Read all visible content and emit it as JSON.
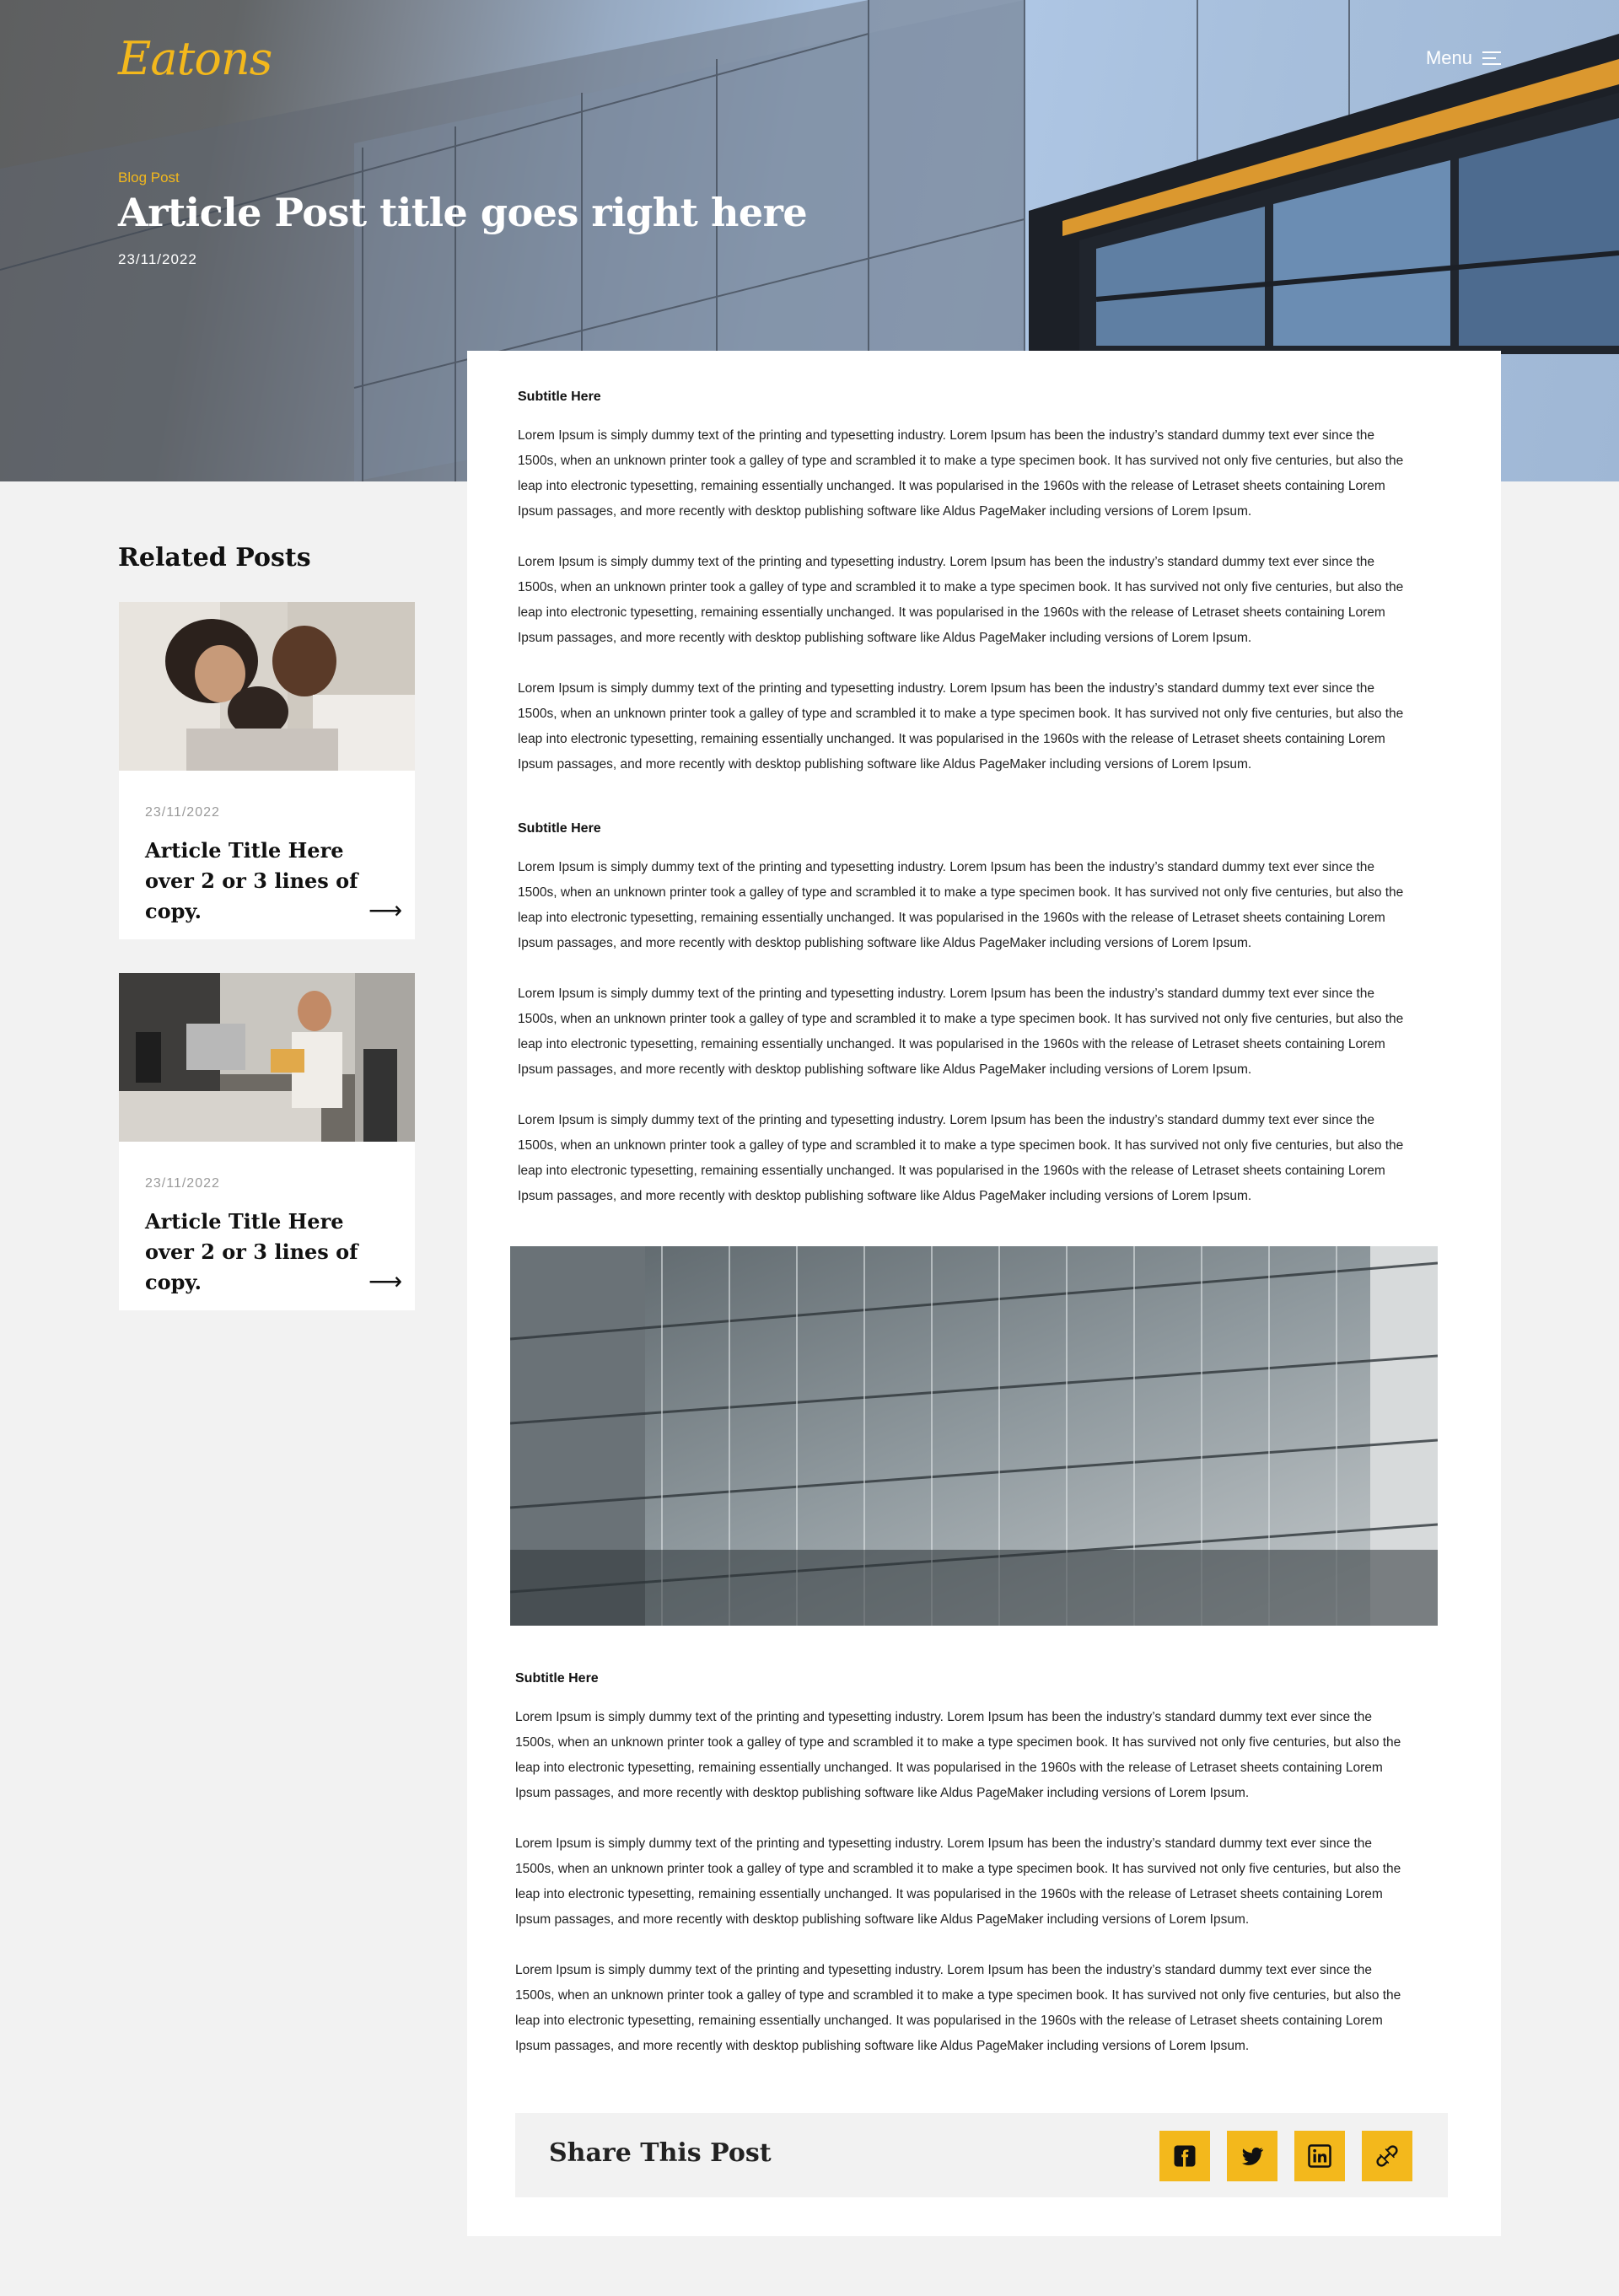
{
  "brand": {
    "logo_text": "Eatons",
    "accent": "#f3b81c"
  },
  "nav": {
    "menu_label": "Menu"
  },
  "hero": {
    "kicker": "Blog Post",
    "title": "Article Post title goes right here",
    "date": "23/11/2022"
  },
  "sidebar": {
    "heading": "Related Posts",
    "cards": [
      {
        "date": "23/11/2022",
        "title": "Article Title Here over 2 or 3 lines of copy.",
        "image": "family-photo"
      },
      {
        "date": "23/11/2022",
        "title": "Article Title Here over 2 or 3 lines of copy.",
        "image": "office-photo"
      }
    ]
  },
  "article": {
    "sections": [
      {
        "subtitle": "Subtitle Here",
        "paragraphs": [
          "Lorem Ipsum is simply dummy text of the printing and typesetting industry. Lorem Ipsum has been the industry’s standard dummy text ever since the 1500s, when an unknown printer took a galley of type and scrambled it to make a type specimen book. It has survived not only five centuries, but also the leap into electronic typesetting, remaining essentially unchanged. It was popularised in the 1960s with the release of Letraset sheets containing Lorem Ipsum passages, and more recently with desktop publishing software like Aldus PageMaker including versions of Lorem Ipsum.",
          "Lorem Ipsum is simply dummy text of the printing and typesetting industry. Lorem Ipsum has been the industry’s standard dummy text ever since the 1500s, when an unknown printer took a galley of type and scrambled it to make a type specimen book. It has survived not only five centuries, but also the leap into electronic typesetting, remaining essentially unchanged. It was popularised in the 1960s with the release of Letraset sheets containing Lorem Ipsum passages, and more recently with desktop publishing software like Aldus PageMaker including versions of Lorem Ipsum.",
          "Lorem Ipsum is simply dummy text of the printing and typesetting industry. Lorem Ipsum has been the industry’s standard dummy text ever since the 1500s, when an unknown printer took a galley of type and scrambled it to make a type specimen book. It has survived not only five centuries, but also the leap into electronic typesetting, remaining essentially unchanged. It was popularised in the 1960s with the release of Letraset sheets containing Lorem Ipsum passages, and more recently with desktop publishing software like Aldus PageMaker including versions of Lorem Ipsum."
        ]
      },
      {
        "subtitle": "Subtitle Here",
        "paragraphs": [
          "Lorem Ipsum is simply dummy text of the printing and typesetting industry. Lorem Ipsum has been the industry’s standard dummy text ever since the 1500s, when an unknown printer took a galley of type and scrambled it to make a type specimen book. It has survived not only five centuries, but also the leap into electronic typesetting, remaining essentially unchanged. It was popularised in the 1960s with the release of Letraset sheets containing Lorem Ipsum passages, and more recently with desktop publishing software like Aldus PageMaker including versions of Lorem Ipsum.",
          "Lorem Ipsum is simply dummy text of the printing and typesetting industry. Lorem Ipsum has been the industry’s standard dummy text ever since the 1500s, when an unknown printer took a galley of type and scrambled it to make a type specimen book. It has survived not only five centuries, but also the leap into electronic typesetting, remaining essentially unchanged. It was popularised in the 1960s with the release of Letraset sheets containing Lorem Ipsum passages, and more recently with desktop publishing software like Aldus PageMaker including versions of Lorem Ipsum.",
          "Lorem Ipsum is simply dummy text of the printing and typesetting industry. Lorem Ipsum has been the industry’s standard dummy text ever since the 1500s, when an unknown printer took a galley of type and scrambled it to make a type specimen book. It has survived not only five centuries, but also the leap into electronic typesetting, remaining essentially unchanged. It was popularised in the 1960s with the release of Letraset sheets containing Lorem Ipsum passages, and more recently with desktop publishing software like Aldus PageMaker including versions of Lorem Ipsum."
        ]
      },
      {
        "subtitle": "Subtitle Here",
        "paragraphs": [
          "Lorem Ipsum is simply dummy text of the printing and typesetting industry. Lorem Ipsum has been the industry’s standard dummy text ever since the 1500s, when an unknown printer took a galley of type and scrambled it to make a type specimen book. It has survived not only five centuries, but also the leap into electronic typesetting, remaining essentially unchanged. It was popularised in the 1960s with the release of Letraset sheets containing Lorem Ipsum passages, and more recently with desktop publishing software like Aldus PageMaker including versions of Lorem Ipsum.",
          "Lorem Ipsum is simply dummy text of the printing and typesetting industry. Lorem Ipsum has been the industry’s standard dummy text ever since the 1500s, when an unknown printer took a galley of type and scrambled it to make a type specimen book. It has survived not only five centuries, but also the leap into electronic typesetting, remaining essentially unchanged. It was popularised in the 1960s with the release of Letraset sheets containing Lorem Ipsum passages, and more recently with desktop publishing software like Aldus PageMaker including versions of Lorem Ipsum.",
          "Lorem Ipsum is simply dummy text of the printing and typesetting industry. Lorem Ipsum has been the industry’s standard dummy text ever since the 1500s, when an unknown printer took a galley of type and scrambled it to make a type specimen book. It has survived not only five centuries, but also the leap into electronic typesetting, remaining essentially unchanged. It was popularised in the 1960s with the release of Letraset sheets containing Lorem Ipsum passages, and more recently with desktop publishing software like Aldus PageMaker including versions of Lorem Ipsum."
        ]
      }
    ],
    "inline_image": "glass-building-facade"
  },
  "share": {
    "label": "Share This Post",
    "buttons": [
      {
        "icon": "facebook-icon"
      },
      {
        "icon": "twitter-icon"
      },
      {
        "icon": "linkedin-icon"
      },
      {
        "icon": "link-icon"
      }
    ]
  }
}
